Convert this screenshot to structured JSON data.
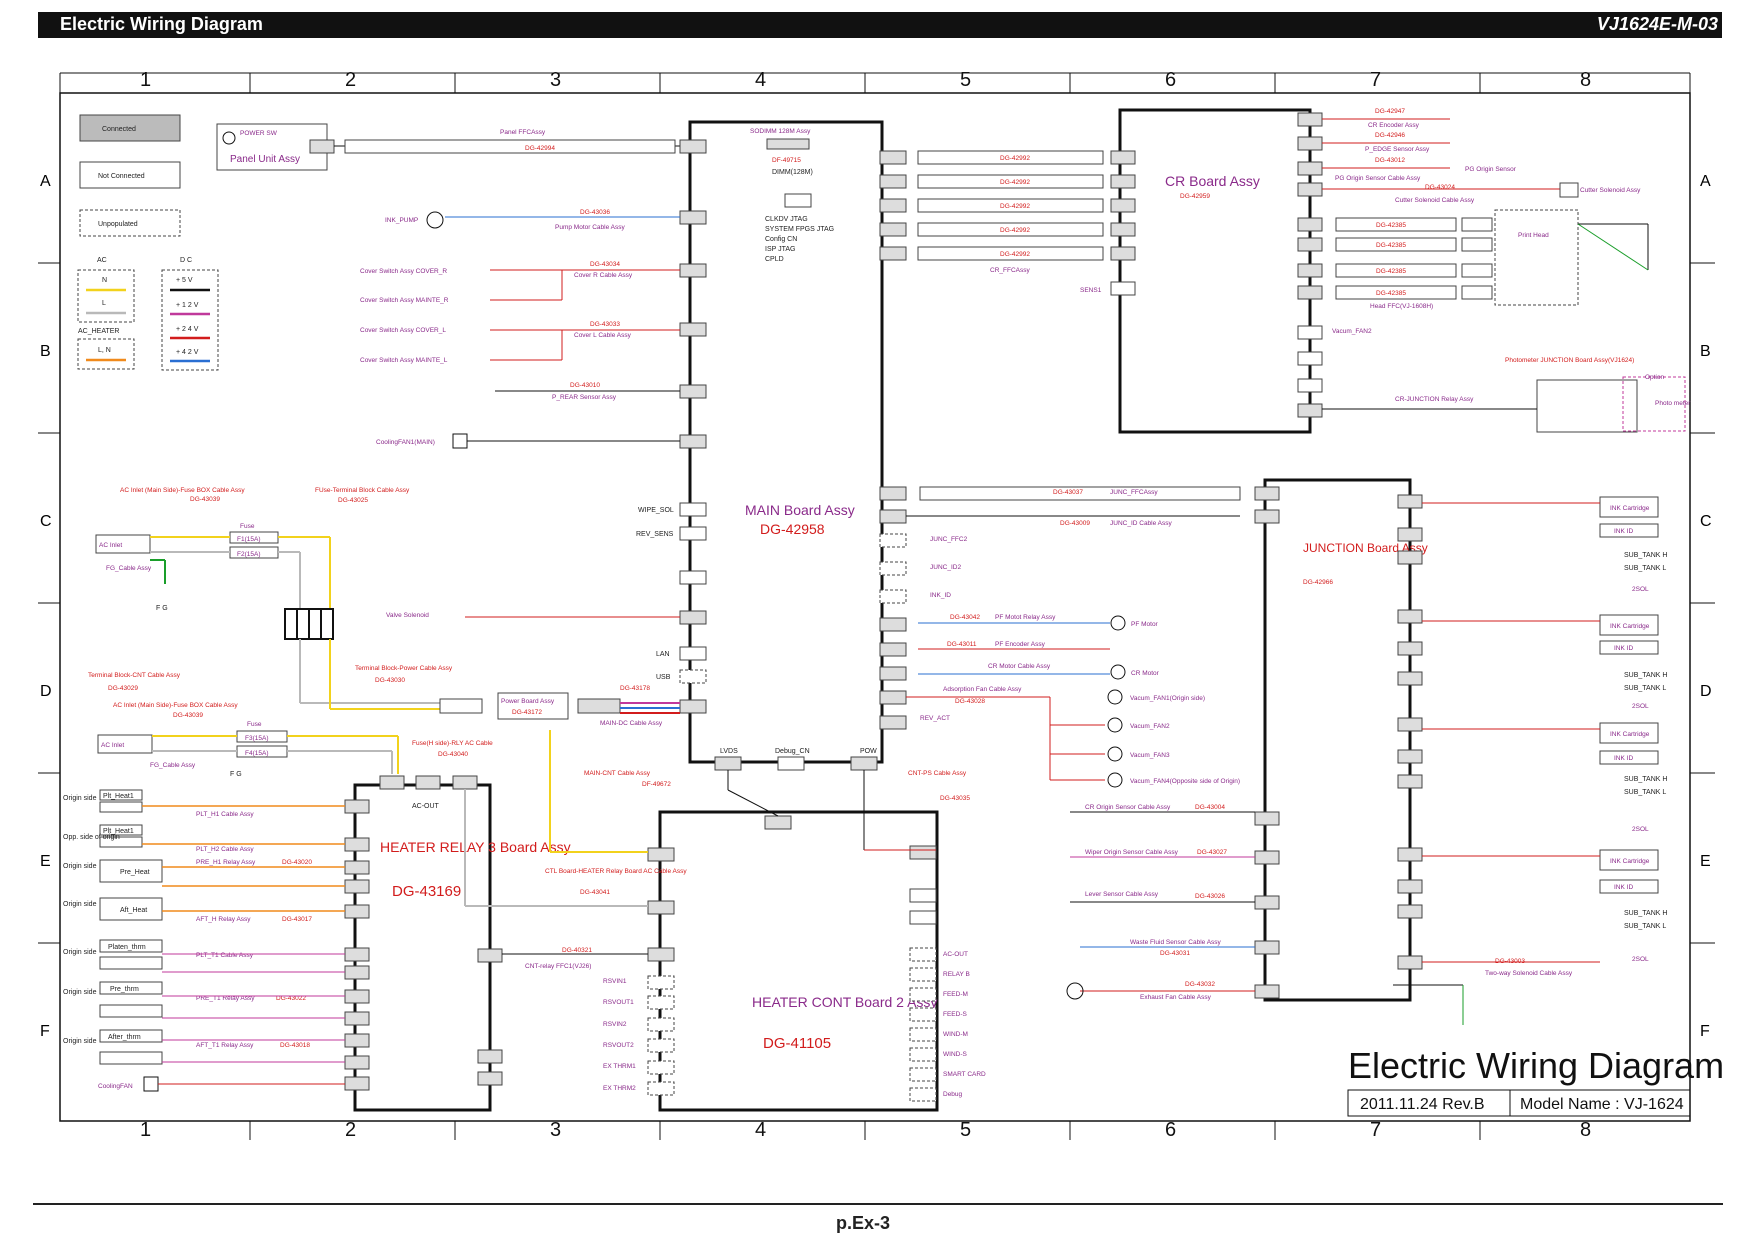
{
  "header": {
    "title": "Electric Wiring Diagram",
    "doc_id": "VJ1624E-M-03"
  },
  "footer": {
    "page": "p.Ex-3"
  },
  "title_block": {
    "title": "Electric Wiring Diagram",
    "date_rev": "2011.11.24 Rev.B",
    "model": "Model Name : VJ-1624"
  },
  "grid": {
    "columns": [
      "1",
      "2",
      "3",
      "4",
      "5",
      "6",
      "7",
      "8"
    ],
    "rows": [
      "A",
      "B",
      "C",
      "D",
      "E",
      "F"
    ]
  },
  "legend": {
    "connected": "Connected",
    "not_connected": "Not Connected",
    "unpopulated": "Unpopulated",
    "ac": "AC",
    "dc": "D C",
    "n": "N",
    "l": "L",
    "ac_heater": "AC_HEATER",
    "ln": "L, N",
    "v5": "+ 5 V",
    "v12": "+ 1 2 V",
    "v24": "+ 2 4 V",
    "v42": "+ 4 2 V",
    "colors": {
      "n": "#f2d21c",
      "l": "#b9b9b9",
      "ac_heater": "#f08a1c",
      "v5": "#111111",
      "v12": "#c0399b",
      "v24": "#d21c1c",
      "v42": "#2a6fd2"
    }
  },
  "boards": {
    "main": {
      "name": "MAIN Board Assy",
      "dg": "DG-42958"
    },
    "cr": {
      "name": "CR Board Assy",
      "dg": "DG-42959"
    },
    "junction": {
      "name": "JUNCTION Board Assy",
      "dg": "DG-42966"
    },
    "relay": {
      "name": "HEATER RELAY 3 Board Assy",
      "dg": "DG-43169"
    },
    "heater": {
      "name": "HEATER CONT Board 2 Assy",
      "dg": "DG-41105"
    },
    "panel": {
      "name": "Panel Unit Assy",
      "sw": "POWER SW"
    },
    "sodimm": {
      "name": "SODIMM 128M Assy",
      "dg": "DF-49715",
      "dimm": "DIMM(128M)"
    },
    "power": {
      "name": "Power Board Assy",
      "dg": "DG-43172"
    }
  },
  "main_notes": [
    "CLKDV JTAG",
    "SYSTEM FPGS JTAG",
    "Config CN",
    "ISP JTAG",
    "CPLD"
  ],
  "cables": {
    "panel": "Panel FFCAssy",
    "panel_dg": "DG-42994",
    "pump": "Pump Motor Cable Assy",
    "pump_dg": "DG-43036",
    "ink_pump": "INK_PUMP",
    "cover_r": "Cover R Cable Assy",
    "cover_r_dg": "DG-43034",
    "cover_l": "Cover L Cable Assy",
    "cover_l_dg": "DG-43033",
    "prear": "P_REAR Sensor Assy",
    "prear_dg": "DG-43010",
    "cooling_main": "CoolingFAN1(MAIN)",
    "cr_ffc": "CR_FFCAssy",
    "cr_ffc_dg": "DG-42992",
    "junc_ffc": "JUNC_FFCAssy",
    "junc_ffc_dg": "DG-43037",
    "junc_id": "JUNC_ID Cable Assy",
    "junc_id_dg": "DG-43009",
    "pf_relay": "PF Motot Relay Assy",
    "pf_relay_dg": "DG-43042",
    "pf_enc": "PF Encoder Assy",
    "pf_enc_dg": "DG-43011",
    "cr_motor": "CR Motor Cable Assy",
    "adsorption": "Adsorption Fan Cable Assy",
    "adsorption_dg": "DG-43028",
    "cnt_ps": "CNT-PS Cable Assy",
    "cnt_ps_dg": "DG-43035",
    "main_cnt": "MAIN-CNT Cable Assy",
    "main_cnt_dg": "DF-49672",
    "main_dc": "MAIN-DC Cable Assy",
    "main_dc_dg": "DG-43178",
    "ac_fuse": "AC Inlet (Main Side)-Fuse BOX Cable Assy",
    "ac_fuse_dg": "DG-43039",
    "fuse_tb": "FUse-Terminal Block Cable Assy",
    "fuse_tb_dg": "DG-43025",
    "tb_cnt": "Terminal Block-CNT Cable Assy",
    "tb_cnt_dg": "DG-43029",
    "tb_power": "Terminal Block-Power Cable Assy",
    "tb_power_dg": "DG-43030",
    "ac_fuse2": "AC Inlet (Main Side)-Fuse BOX Cable Assy",
    "ac_fuse2_dg": "DG-43039",
    "fuse_rly": "Fuse(H side)-RLY AC Cable",
    "fuse_rly_dg": "DG-43040",
    "ctl_relay": "CTL Board-HEATER Relay Board AC Cable Assy",
    "ctl_relay_dg": "DG-43041",
    "cnt_relay": "CNT-relay FFC1(VJ26)",
    "cnt_relay_dg": "DG-40321",
    "cr_origin": "CR Origin Sensor Cable Assy",
    "cr_origin_dg": "DG-43004",
    "wiper": "Wiper Origin Sensor Cable Assy",
    "wiper_dg": "DG-43027",
    "lever": "Lever Sensor Cable Assy",
    "lever_dg": "DG-43026",
    "waste": "Waste Fluid Sensor Cable Assy",
    "waste_dg": "DG-43031",
    "exhaust": "Exhaust Fan Cable Assy",
    "exhaust_dg": "DG-43032",
    "two_way": "Two-way Solenoid Cable Assy",
    "two_way_dg": "DG-43003",
    "head_ffc": "Head FFC(VJ-1608H)",
    "cr_jct": "CR-JUNCTION Relay Assy",
    "photo_jct": "Photometer JUNCTION Board Assy(VJ1624)",
    "cr_enc": "CR Encoder Assy",
    "cr_enc_dg": "DG-42947",
    "pedge": "P_EDGE Sensor Assy",
    "pedge_dg": "DG-42946",
    "pg_origin": "PG Origin Sensor Cable Assy",
    "pg_origin_dg": "DG-43012",
    "cutter": "Cutter Solenoid Cable Assy",
    "cutter_dg": "DG-43024",
    "head_dg": "DG-42385"
  },
  "parts": {
    "cover_r": "Cover Switch Assy COVER_R",
    "mainte_r": "Cover Switch Assy MAINTE_R",
    "cover_l": "Cover Switch Assy COVER_L",
    "mainte_l": "Cover Switch Assy MAINTE_L",
    "valve": "Valve Solenoid",
    "ac_inlet": "AC Inlet",
    "fg_cable": "FG_Cable Assy",
    "fg": "F G",
    "fuse": "Fuse",
    "f1": "F1(15A)",
    "f2": "F2(15A)",
    "f3": "F3(15A)",
    "f4": "F4(15A)",
    "pf_motor": "PF Motor",
    "cr_motor": "CR Motor",
    "vac1": "Vacum_FAN1(Origin side)",
    "vac2": "Vacum_FAN2",
    "vac3": "Vacum_FAN3",
    "vac4": "Vacum_FAN4(Opposite side of Origin)",
    "print_head": "Print Head",
    "cutter_sol": "Cutter Solenoid Assy",
    "pg_origin_sensor": "PG Origin Sensor",
    "photo": "Photo meter",
    "option": "Option",
    "ink_cart": "INK Cartridge",
    "ink_id": "INK ID",
    "sub_h": "SUB_TANK H",
    "sub_l": "SUB_TANK L",
    "sol2": "2SOL",
    "cooling_fan": "CoolingFAN"
  },
  "heater_left": [
    {
      "side": "Origin side",
      "part": "Plt_Heat1",
      "cable": "PLT_H1 Cable Assy"
    },
    {
      "side": "Opp. side of origin",
      "part": "Plt_Heat1",
      "cable": "PLT_H2 Cable Assy"
    },
    {
      "side": "Origin side",
      "part": "Pre_Heat",
      "cable": "PRE_H1 Relay Assy",
      "dg": "DG-43020"
    },
    {
      "side": "Origin side",
      "part": "Aft_Heat",
      "cable": "AFT_H Relay Assy",
      "dg": "DG-43017"
    },
    {
      "side": "Origin side",
      "part": "Platen_thrm",
      "cable": "PLT_T1 Cable Assy"
    },
    {
      "side": "Origin side",
      "part": "Pre_thrm",
      "cable": "PRE_T1 Relay Assy",
      "dg": "DG-43022"
    },
    {
      "side": "Origin side",
      "part": "After_thrm",
      "cable": "AFT_T1 Relay Assy",
      "dg": "DG-43018"
    }
  ],
  "heater_signals": [
    "RSVIN1",
    "RSVOUT1",
    "RSVIN2",
    "RSVOUT2",
    "EX THRM1",
    "EX THRM2"
  ],
  "heater_right": [
    "AC-OUT",
    "RELAY B",
    "FEED-M",
    "FEED-S",
    "WIND-M",
    "WIND-S",
    "SMART CARD",
    "Debug"
  ],
  "main_signals": [
    "WIPE_SOL",
    "REV_SENS",
    "LAN",
    "USB",
    "LVDS",
    "Debug_CN",
    "POW",
    "SENS1",
    "JUNC_FFC2",
    "JUNC_ID2",
    "INK_ID",
    "REV_ACT"
  ]
}
